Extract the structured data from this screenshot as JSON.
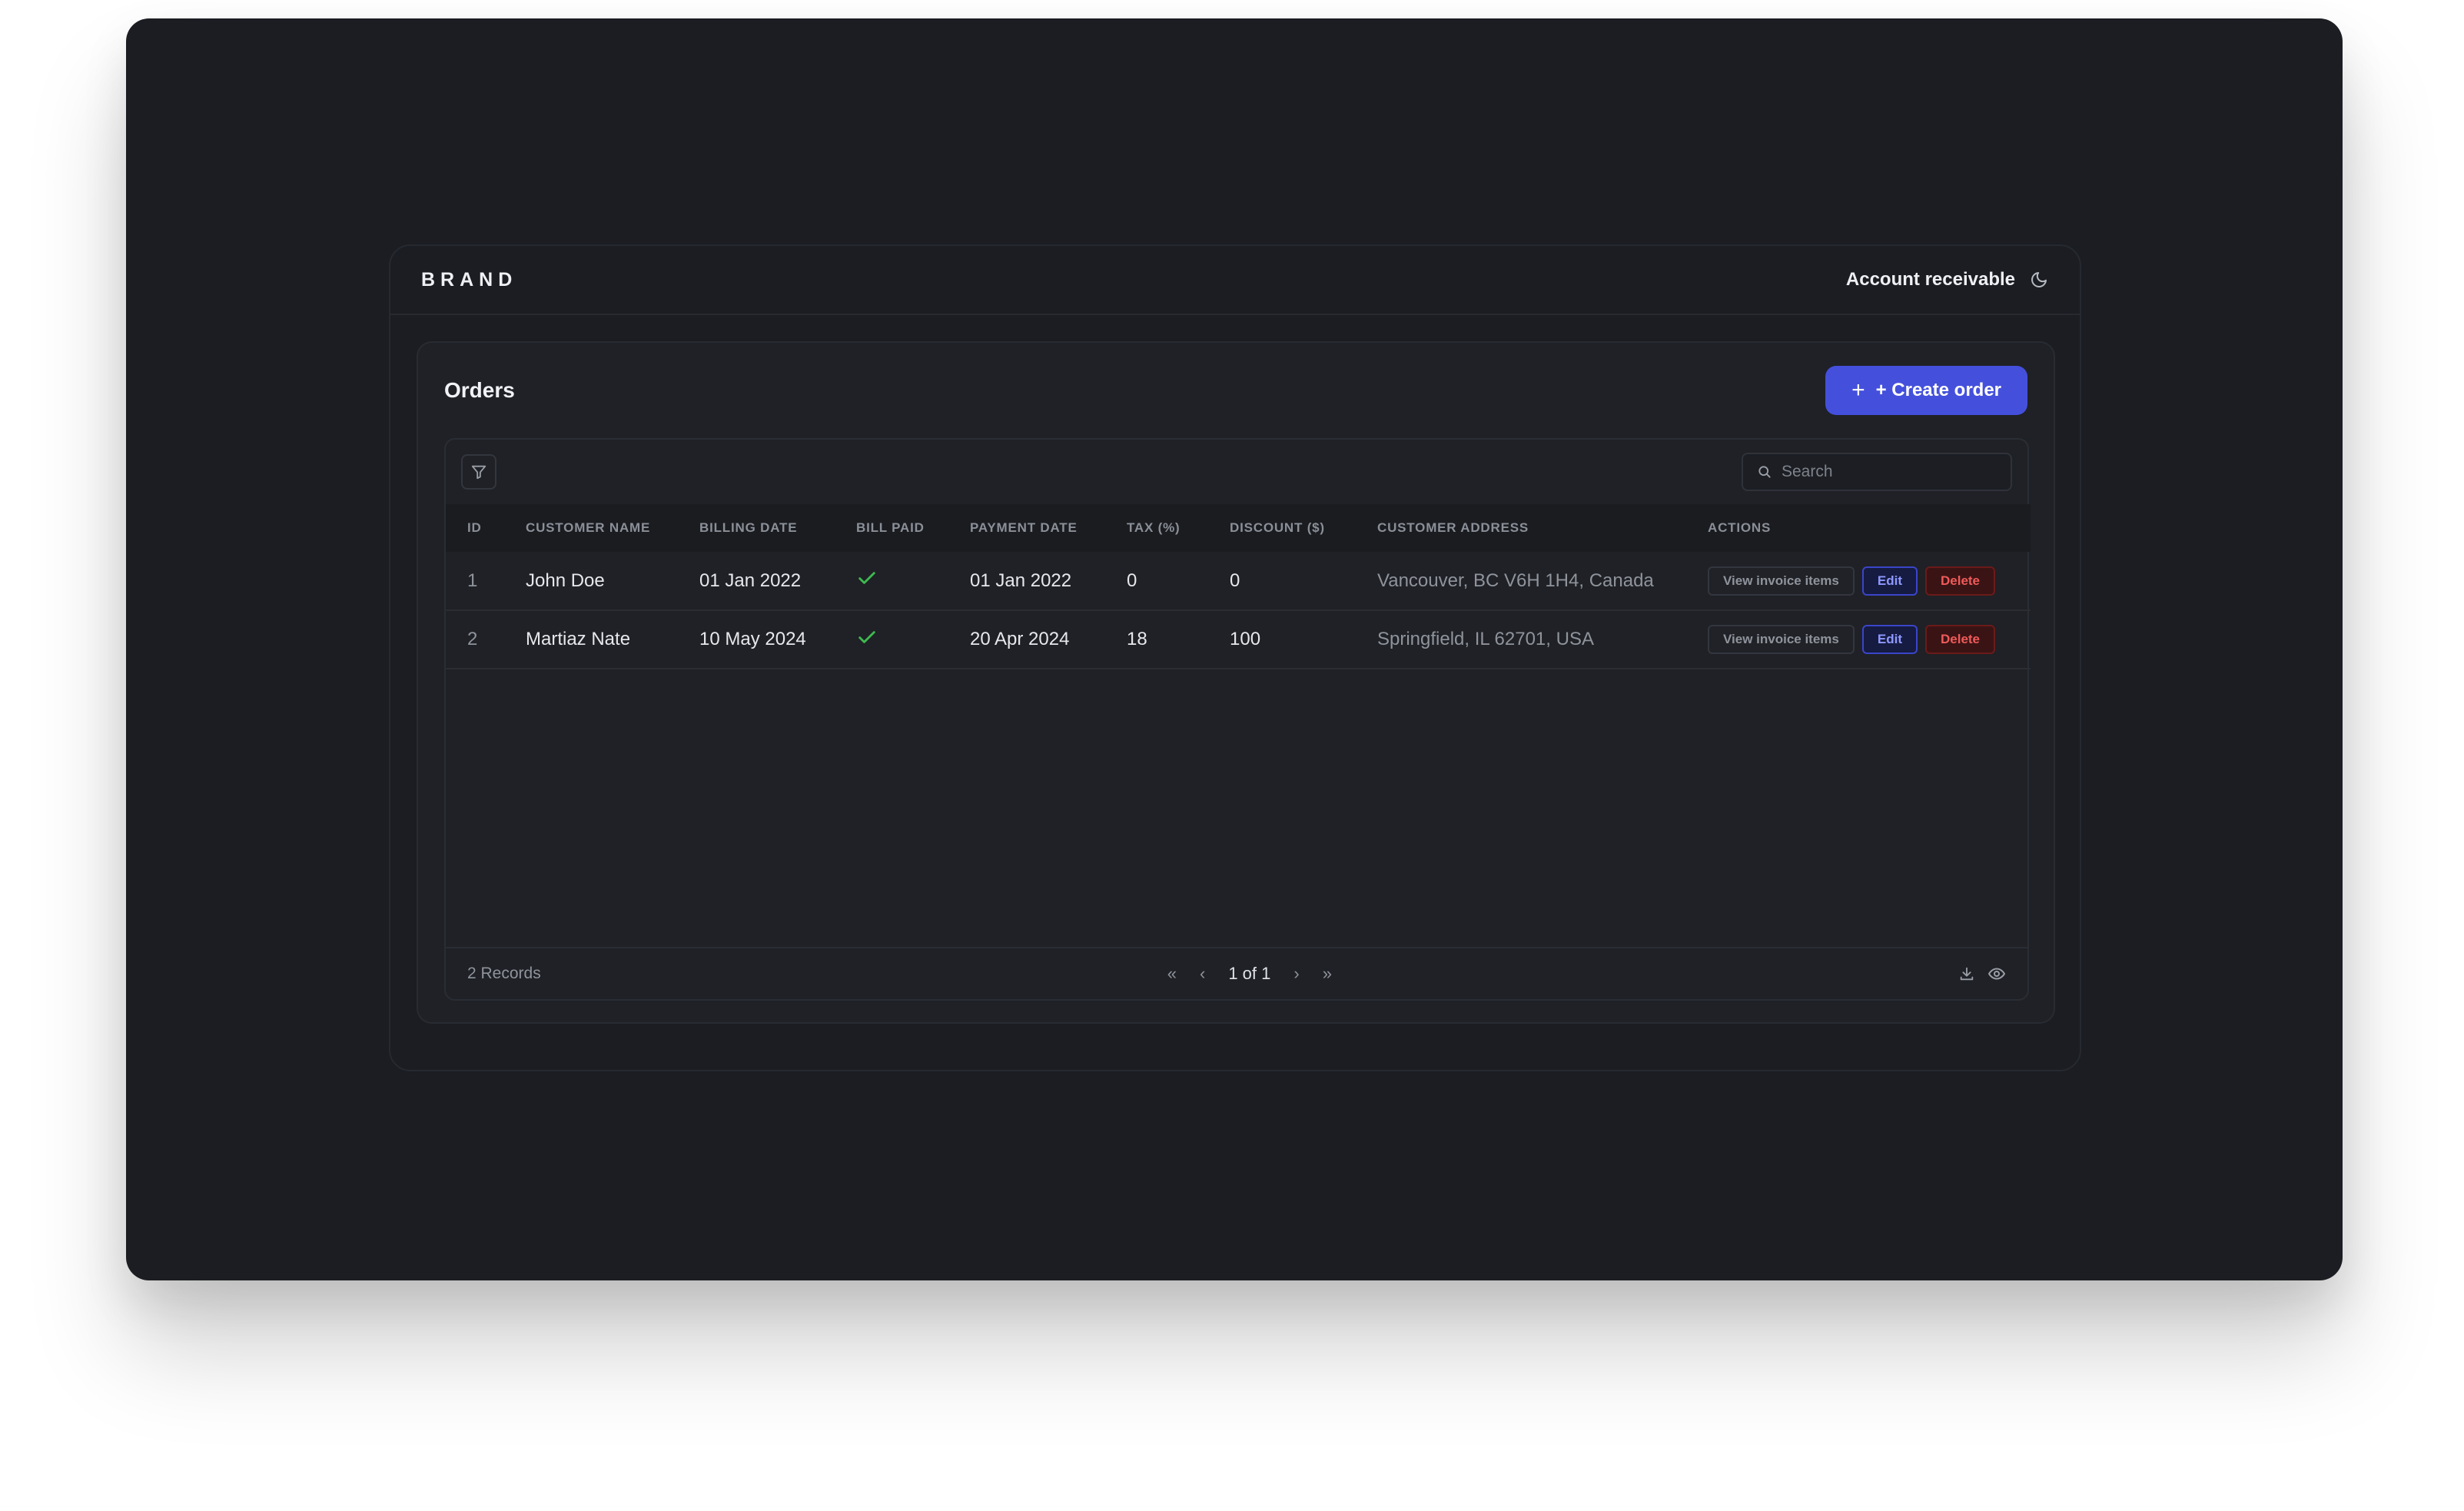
{
  "app": {
    "brand": "BRAND",
    "account_label": "Account receivable",
    "theme_icon": "moon-icon"
  },
  "orders": {
    "title": "Orders",
    "create_button": "+ Create order",
    "search_placeholder": "Search",
    "columns": [
      "ID",
      "CUSTOMER NAME",
      "BILLING DATE",
      "BILL PAID",
      "PAYMENT DATE",
      "TAX (%)",
      "DISCOUNT ($)",
      "CUSTOMER ADDRESS",
      "ACTIONS"
    ],
    "rows": [
      {
        "id": "1",
        "customer_name": "John Doe",
        "billing_date": "01 Jan 2022",
        "bill_paid": true,
        "payment_date": "01 Jan 2022",
        "tax": "0",
        "discount": "0",
        "address": "Vancouver, BC V6H 1H4, Canada"
      },
      {
        "id": "2",
        "customer_name": "Martiaz Nate",
        "billing_date": "10 May 2024",
        "bill_paid": true,
        "payment_date": "20 Apr 2024",
        "tax": "18",
        "discount": "100",
        "address": "Springfield, IL 62701, USA"
      }
    ],
    "action_labels": {
      "view": "View invoice items",
      "edit": "Edit",
      "delete": "Delete"
    },
    "footer": {
      "records": "2 Records",
      "page_info": "1 of 1"
    }
  },
  "colors": {
    "accent": "#4450dc",
    "success": "#3fb950",
    "danger": "#f05a5a"
  }
}
